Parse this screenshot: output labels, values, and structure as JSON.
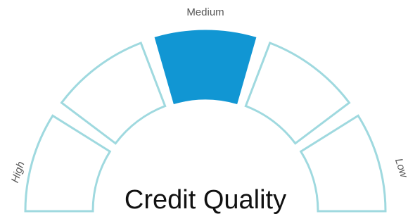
{
  "chart_data": {
    "type": "gauge",
    "title": "Credit Quality",
    "segments": [
      "High",
      "",
      "Medium",
      "",
      "Low"
    ],
    "selected_index": 2,
    "labels": {
      "left": "High",
      "top": "Medium",
      "right": "Low"
    }
  },
  "colors": {
    "active_fill": "#1196d3",
    "outline": "#9fd9df",
    "title": "#111111",
    "label": "#555555"
  }
}
